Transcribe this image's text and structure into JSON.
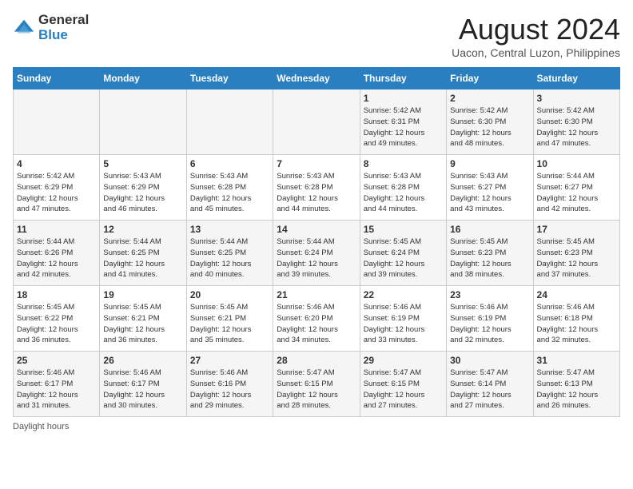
{
  "header": {
    "logo_general": "General",
    "logo_blue": "Blue",
    "month_year": "August 2024",
    "location": "Uacon, Central Luzon, Philippines"
  },
  "days_of_week": [
    "Sunday",
    "Monday",
    "Tuesday",
    "Wednesday",
    "Thursday",
    "Friday",
    "Saturday"
  ],
  "weeks": [
    [
      {
        "day": "",
        "info": ""
      },
      {
        "day": "",
        "info": ""
      },
      {
        "day": "",
        "info": ""
      },
      {
        "day": "",
        "info": ""
      },
      {
        "day": "1",
        "info": "Sunrise: 5:42 AM\nSunset: 6:31 PM\nDaylight: 12 hours\nand 49 minutes."
      },
      {
        "day": "2",
        "info": "Sunrise: 5:42 AM\nSunset: 6:30 PM\nDaylight: 12 hours\nand 48 minutes."
      },
      {
        "day": "3",
        "info": "Sunrise: 5:42 AM\nSunset: 6:30 PM\nDaylight: 12 hours\nand 47 minutes."
      }
    ],
    [
      {
        "day": "4",
        "info": "Sunrise: 5:42 AM\nSunset: 6:29 PM\nDaylight: 12 hours\nand 47 minutes."
      },
      {
        "day": "5",
        "info": "Sunrise: 5:43 AM\nSunset: 6:29 PM\nDaylight: 12 hours\nand 46 minutes."
      },
      {
        "day": "6",
        "info": "Sunrise: 5:43 AM\nSunset: 6:28 PM\nDaylight: 12 hours\nand 45 minutes."
      },
      {
        "day": "7",
        "info": "Sunrise: 5:43 AM\nSunset: 6:28 PM\nDaylight: 12 hours\nand 44 minutes."
      },
      {
        "day": "8",
        "info": "Sunrise: 5:43 AM\nSunset: 6:28 PM\nDaylight: 12 hours\nand 44 minutes."
      },
      {
        "day": "9",
        "info": "Sunrise: 5:43 AM\nSunset: 6:27 PM\nDaylight: 12 hours\nand 43 minutes."
      },
      {
        "day": "10",
        "info": "Sunrise: 5:44 AM\nSunset: 6:27 PM\nDaylight: 12 hours\nand 42 minutes."
      }
    ],
    [
      {
        "day": "11",
        "info": "Sunrise: 5:44 AM\nSunset: 6:26 PM\nDaylight: 12 hours\nand 42 minutes."
      },
      {
        "day": "12",
        "info": "Sunrise: 5:44 AM\nSunset: 6:25 PM\nDaylight: 12 hours\nand 41 minutes."
      },
      {
        "day": "13",
        "info": "Sunrise: 5:44 AM\nSunset: 6:25 PM\nDaylight: 12 hours\nand 40 minutes."
      },
      {
        "day": "14",
        "info": "Sunrise: 5:44 AM\nSunset: 6:24 PM\nDaylight: 12 hours\nand 39 minutes."
      },
      {
        "day": "15",
        "info": "Sunrise: 5:45 AM\nSunset: 6:24 PM\nDaylight: 12 hours\nand 39 minutes."
      },
      {
        "day": "16",
        "info": "Sunrise: 5:45 AM\nSunset: 6:23 PM\nDaylight: 12 hours\nand 38 minutes."
      },
      {
        "day": "17",
        "info": "Sunrise: 5:45 AM\nSunset: 6:23 PM\nDaylight: 12 hours\nand 37 minutes."
      }
    ],
    [
      {
        "day": "18",
        "info": "Sunrise: 5:45 AM\nSunset: 6:22 PM\nDaylight: 12 hours\nand 36 minutes."
      },
      {
        "day": "19",
        "info": "Sunrise: 5:45 AM\nSunset: 6:21 PM\nDaylight: 12 hours\nand 36 minutes."
      },
      {
        "day": "20",
        "info": "Sunrise: 5:45 AM\nSunset: 6:21 PM\nDaylight: 12 hours\nand 35 minutes."
      },
      {
        "day": "21",
        "info": "Sunrise: 5:46 AM\nSunset: 6:20 PM\nDaylight: 12 hours\nand 34 minutes."
      },
      {
        "day": "22",
        "info": "Sunrise: 5:46 AM\nSunset: 6:19 PM\nDaylight: 12 hours\nand 33 minutes."
      },
      {
        "day": "23",
        "info": "Sunrise: 5:46 AM\nSunset: 6:19 PM\nDaylight: 12 hours\nand 32 minutes."
      },
      {
        "day": "24",
        "info": "Sunrise: 5:46 AM\nSunset: 6:18 PM\nDaylight: 12 hours\nand 32 minutes."
      }
    ],
    [
      {
        "day": "25",
        "info": "Sunrise: 5:46 AM\nSunset: 6:17 PM\nDaylight: 12 hours\nand 31 minutes."
      },
      {
        "day": "26",
        "info": "Sunrise: 5:46 AM\nSunset: 6:17 PM\nDaylight: 12 hours\nand 30 minutes."
      },
      {
        "day": "27",
        "info": "Sunrise: 5:46 AM\nSunset: 6:16 PM\nDaylight: 12 hours\nand 29 minutes."
      },
      {
        "day": "28",
        "info": "Sunrise: 5:47 AM\nSunset: 6:15 PM\nDaylight: 12 hours\nand 28 minutes."
      },
      {
        "day": "29",
        "info": "Sunrise: 5:47 AM\nSunset: 6:15 PM\nDaylight: 12 hours\nand 27 minutes."
      },
      {
        "day": "30",
        "info": "Sunrise: 5:47 AM\nSunset: 6:14 PM\nDaylight: 12 hours\nand 27 minutes."
      },
      {
        "day": "31",
        "info": "Sunrise: 5:47 AM\nSunset: 6:13 PM\nDaylight: 12 hours\nand 26 minutes."
      }
    ]
  ],
  "footer": {
    "daylight_label": "Daylight hours"
  }
}
